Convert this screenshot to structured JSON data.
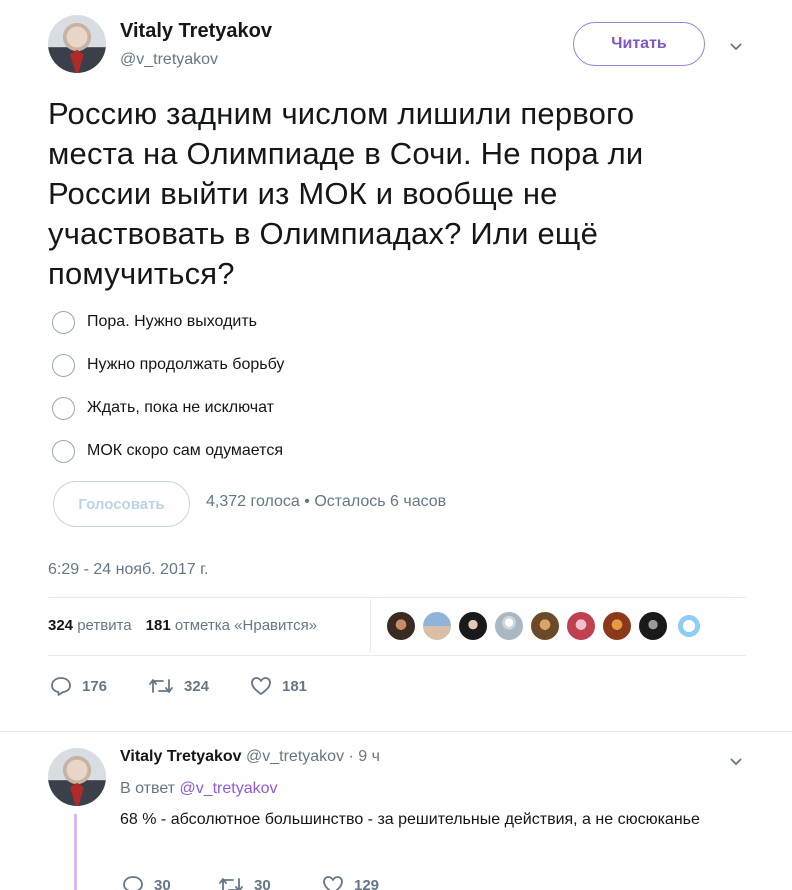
{
  "tweet": {
    "author_name": "Vitaly Tretyakov",
    "author_handle": "@v_tretyakov",
    "follow_label": "Читать",
    "text": "Россию задним числом лишили первого места на Олимпиаде в Сочи. Не пора ли России выйти из МОК и вообще не участвовать в Олимпиадах? Или ещё помучиться?",
    "poll": {
      "options": [
        "Пора. Нужно выходить",
        "Нужно продолжать борьбу",
        "Ждать, пока не исключат",
        "МОК скоро сам одумается"
      ],
      "vote_label": "Голосовать",
      "meta": "4,372 голоса • Осталось 6 часов"
    },
    "timestamp": "6:29 - 24 нояб. 2017 г.",
    "stats": {
      "retweets_count": "324",
      "retweets_label": "ретвита",
      "likes_count": "181",
      "likes_label": "отметка «Нравится»"
    },
    "actions": {
      "reply_count": "176",
      "retweet_count": "324",
      "like_count": "181"
    }
  },
  "reply": {
    "author_name": "Vitaly Tretyakov",
    "handle_time": "@v_tretyakov · 9 ч",
    "in_reply_prefix": "В ответ",
    "in_reply_handle": "@v_tretyakov",
    "text": "68 % - абсолютное большинство - за решительные действия, а не сюсюканье",
    "actions": {
      "reply_count": "30",
      "retweet_count": "30",
      "like_count": "129"
    }
  },
  "colors": {
    "accent": "#7e57c2",
    "text": "#14171a",
    "muted": "#657786",
    "vote_disabled": "#b8d4e8"
  }
}
